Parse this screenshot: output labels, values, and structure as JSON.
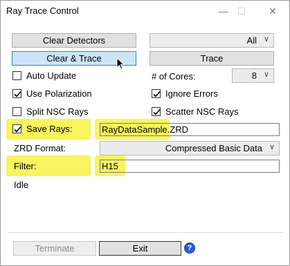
{
  "window": {
    "title": "Ray Trace Control",
    "minimize_glyph": "—",
    "maximize_glyph": "☐",
    "close_glyph": "✕"
  },
  "buttons": {
    "clear_detectors": "Clear Detectors",
    "clear_trace": "Clear & Trace",
    "trace": "Trace",
    "terminate": "Terminate",
    "exit": "Exit",
    "help": "?"
  },
  "detector_select": {
    "value": "All"
  },
  "options": {
    "auto_update": {
      "label": "Auto Update",
      "checked": false
    },
    "use_polarization": {
      "label": "Use Polarization",
      "checked": true
    },
    "split_nsc_rays": {
      "label": "Split NSC Rays",
      "checked": false
    },
    "ignore_errors": {
      "label": "Ignore Errors",
      "checked": true
    },
    "scatter_nsc_rays": {
      "label": "Scatter NSC Rays",
      "checked": true
    },
    "save_rays": {
      "label": "Save Rays:",
      "checked": true
    }
  },
  "cores": {
    "label": "# of Cores:",
    "value": "8"
  },
  "save_rays_file": "RayDataSample.ZRD",
  "zrd_format": {
    "label": "ZRD Format:",
    "value": "Compressed Basic Data"
  },
  "filter": {
    "label": "Filter:",
    "value": "H15"
  },
  "status": "Idle",
  "colors": {
    "highlight": "#f7f45e",
    "primary_button": "#cce4f7",
    "help_icon": "#2a5bd7"
  }
}
